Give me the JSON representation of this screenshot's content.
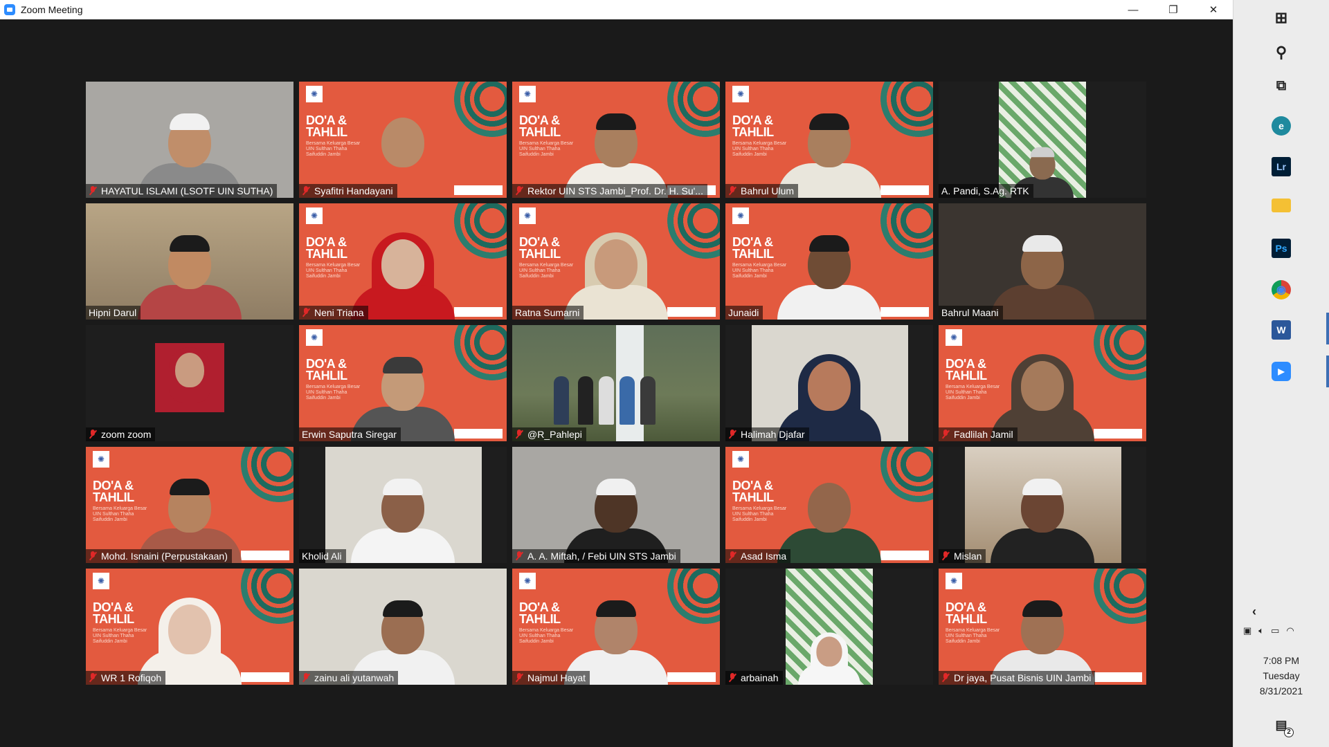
{
  "window": {
    "title": "Zoom Meeting",
    "controls": {
      "minimize": "—",
      "restore": "❐",
      "close": "✕"
    }
  },
  "poster": {
    "title_line1": "DO'A &",
    "title_line2": "TAHLIL",
    "subtitle": "Bersama Keluarga Besar UIN Sulthan Thaha Saifuddin Jambi"
  },
  "participants": [
    {
      "name": "HAYATUL ISLAMI (LSOTF UIN SUTHA)",
      "muted": true
    },
    {
      "name": "Syafitri Handayani",
      "muted": true
    },
    {
      "name": "Rektor UIN STS Jambi_Prof. Dr. H. Su'...",
      "muted": true
    },
    {
      "name": "Bahrul Ulum",
      "muted": true
    },
    {
      "name": "A. Pandi, S.Ag. RTK",
      "muted": false
    },
    {
      "name": "Hipni Darul",
      "muted": false
    },
    {
      "name": "Neni Triana",
      "muted": true
    },
    {
      "name": "Ratna Sumarni",
      "muted": false
    },
    {
      "name": "Junaidi",
      "muted": false
    },
    {
      "name": "Bahrul Maani",
      "muted": false
    },
    {
      "name": "zoom zoom",
      "muted": true
    },
    {
      "name": "Erwin Saputra Siregar",
      "muted": false
    },
    {
      "name": "@R_Pahlepi",
      "muted": true
    },
    {
      "name": "Halimah Djafar",
      "muted": true
    },
    {
      "name": "Fadlilah Jamil",
      "muted": true
    },
    {
      "name": "Mohd. Isnaini (Perpustakaan)",
      "muted": true
    },
    {
      "name": "Kholid Ali",
      "muted": false
    },
    {
      "name": "A. A. Miftah, / Febi UIN STS Jambi",
      "muted": true
    },
    {
      "name": "Asad Isma",
      "muted": true
    },
    {
      "name": "Mislan",
      "muted": true
    },
    {
      "name": "WR 1 Rofiqoh",
      "muted": true
    },
    {
      "name": "zainu ali yutanwah",
      "muted": true
    },
    {
      "name": "Najmul Hayat",
      "muted": true
    },
    {
      "name": "arbainah",
      "muted": true
    },
    {
      "name": "Dr jaya, Pusat Bisnis UIN Jambi",
      "muted": true
    }
  ],
  "taskbar": {
    "apps": [
      {
        "name": "windows-start",
        "glyph": "⊞"
      },
      {
        "name": "search",
        "glyph": "⚲"
      },
      {
        "name": "task-view",
        "glyph": "⧉"
      },
      {
        "name": "edge",
        "glyph": "e"
      },
      {
        "name": "lightroom",
        "glyph": "Lr"
      },
      {
        "name": "file-explorer",
        "glyph": "▬"
      },
      {
        "name": "photoshop",
        "glyph": "Ps"
      },
      {
        "name": "chrome",
        "glyph": "◉"
      },
      {
        "name": "word",
        "glyph": "W"
      },
      {
        "name": "zoom",
        "glyph": "▶"
      }
    ],
    "clock": {
      "time": "7:08 PM",
      "day": "Tuesday",
      "date": "8/31/2021"
    },
    "notification_count": "2",
    "colors": {
      "accent": "#3d6fb4"
    }
  },
  "colors": {
    "poster_orange": "#e35a3f",
    "active_speaker": "#d8e25a",
    "mic_muted": "#e02828"
  }
}
